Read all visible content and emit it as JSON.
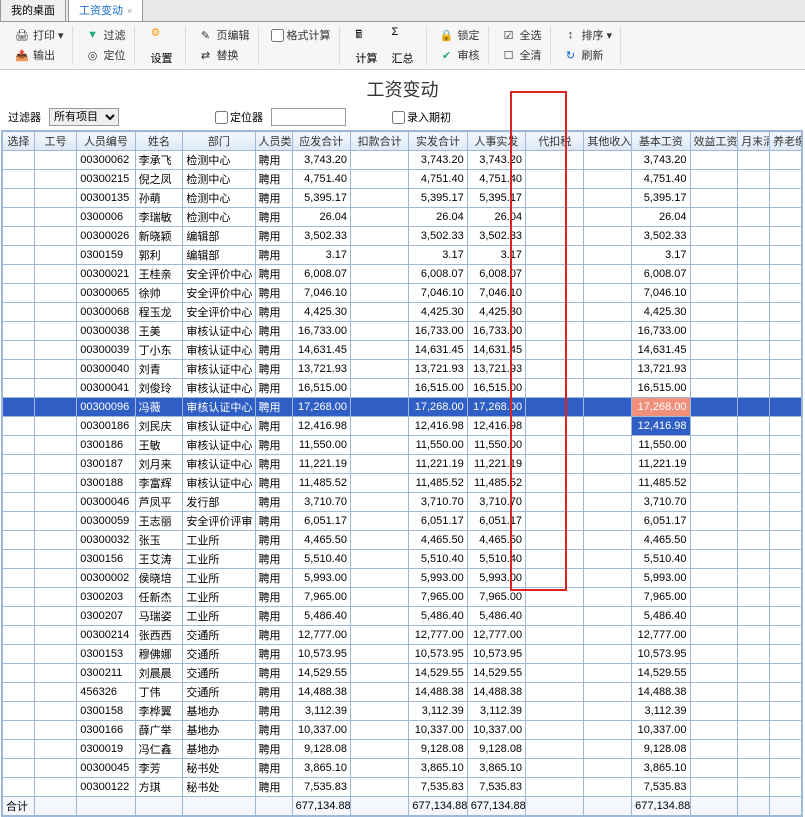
{
  "tabs": {
    "desktop": "我的桌面",
    "payroll": "工资变动"
  },
  "toolbar": {
    "print": "打印",
    "filter": "过滤",
    "output": "输出",
    "locate": "定位",
    "settings": "设置",
    "page_edit": "页编辑",
    "format_calc": "格式计算",
    "replace": "替换",
    "calc": "计算",
    "summary": "汇总",
    "lock": "锁定",
    "audit": "审核",
    "select_all": "全选",
    "clear_all": "全清",
    "sort": "排序",
    "refresh": "刷新"
  },
  "title": "工资变动",
  "filters": {
    "filter_label": "过滤器",
    "filter_value": "所有项目",
    "locator_label": "定位器",
    "import_period": "录入期初"
  },
  "columns": {
    "select": "选择",
    "work_no": "工号",
    "emp_no": "人员编号",
    "name": "姓名",
    "dept": "部门",
    "emp_type": "人员类别",
    "gross": "应发合计",
    "deduct": "扣款合计",
    "net": "实发合计",
    "hr_net": "人事实发",
    "tax": "代扣税",
    "other_income": "其他收入",
    "base": "基本工资",
    "benefit": "效益工资",
    "month_adj": "月末清欠",
    "pension": "养老缴"
  },
  "rows": [
    {
      "no": "00300062",
      "name": "李承飞",
      "dept": "检测中心",
      "type": "聘用",
      "gross": "3,743.20",
      "deduct": "",
      "net": "3,743.20",
      "hr": "3,743.20",
      "base": "3,743.20"
    },
    {
      "no": "00300215",
      "name": "倪之凤",
      "dept": "检测中心",
      "type": "聘用",
      "gross": "4,751.40",
      "deduct": "",
      "net": "4,751.40",
      "hr": "4,751.40",
      "base": "4,751.40"
    },
    {
      "no": "00300135",
      "name": "孙萌",
      "dept": "检测中心",
      "type": "聘用",
      "gross": "5,395.17",
      "deduct": "",
      "net": "5,395.17",
      "hr": "5,395.17",
      "base": "5,395.17"
    },
    {
      "no": "0300006",
      "name": "李瑞敏",
      "dept": "检测中心",
      "type": "聘用",
      "gross": "26.04",
      "deduct": "",
      "net": "26.04",
      "hr": "26.04",
      "base": "26.04"
    },
    {
      "no": "00300026",
      "name": "新晓颖",
      "dept": "编辑部",
      "type": "聘用",
      "gross": "3,502.33",
      "deduct": "",
      "net": "3,502.33",
      "hr": "3,502.33",
      "base": "3,502.33"
    },
    {
      "no": "0300159",
      "name": "郭利",
      "dept": "编辑部",
      "type": "聘用",
      "gross": "3.17",
      "deduct": "",
      "net": "3.17",
      "hr": "3.17",
      "base": "3.17"
    },
    {
      "no": "00300021",
      "name": "王桂亲",
      "dept": "安全评价中心",
      "type": "聘用",
      "gross": "6,008.07",
      "deduct": "",
      "net": "6,008.07",
      "hr": "6,008.07",
      "base": "6,008.07"
    },
    {
      "no": "00300065",
      "name": "徐帅",
      "dept": "安全评价中心",
      "type": "聘用",
      "gross": "7,046.10",
      "deduct": "",
      "net": "7,046.10",
      "hr": "7,046.10",
      "base": "7,046.10"
    },
    {
      "no": "00300068",
      "name": "程玉龙",
      "dept": "安全评价中心",
      "type": "聘用",
      "gross": "4,425.30",
      "deduct": "",
      "net": "4,425.30",
      "hr": "4,425.30",
      "base": "4,425.30"
    },
    {
      "no": "00300038",
      "name": "王美",
      "dept": "审核认证中心",
      "type": "聘用",
      "gross": "16,733.00",
      "deduct": "",
      "net": "16,733.00",
      "hr": "16,733.00",
      "base": "16,733.00"
    },
    {
      "no": "00300039",
      "name": "丁小东",
      "dept": "审核认证中心",
      "type": "聘用",
      "gross": "14,631.45",
      "deduct": "",
      "net": "14,631.45",
      "hr": "14,631.45",
      "base": "14,631.45"
    },
    {
      "no": "00300040",
      "name": "刘青",
      "dept": "审核认证中心",
      "type": "聘用",
      "gross": "13,721.93",
      "deduct": "",
      "net": "13,721.93",
      "hr": "13,721.93",
      "base": "13,721.93"
    },
    {
      "no": "00300041",
      "name": "刘俊玲",
      "dept": "审核认证中心",
      "type": "聘用",
      "gross": "16,515.00",
      "deduct": "",
      "net": "16,515.00",
      "hr": "16,515.00",
      "base": "16,515.00"
    },
    {
      "no": "00300096",
      "name": "冯薇",
      "dept": "审核认证中心",
      "type": "聘用",
      "gross": "17,268.00",
      "deduct": "",
      "net": "17,268.00",
      "hr": "17,268.00",
      "base": "17,268.00",
      "sel": true,
      "hl": true
    },
    {
      "no": "00300186",
      "name": "刘民庆",
      "dept": "审核认证中心",
      "type": "聘用",
      "gross": "12,416.98",
      "deduct": "",
      "net": "12,416.98",
      "hr": "12,416.98",
      "base": "12,416.98",
      "hl2": true
    },
    {
      "no": "0300186",
      "name": "王敏",
      "dept": "审核认证中心",
      "type": "聘用",
      "gross": "11,550.00",
      "deduct": "",
      "net": "11,550.00",
      "hr": "11,550.00",
      "base": "11,550.00"
    },
    {
      "no": "0300187",
      "name": "刘月来",
      "dept": "审核认证中心",
      "type": "聘用",
      "gross": "11,221.19",
      "deduct": "",
      "net": "11,221.19",
      "hr": "11,221.19",
      "base": "11,221.19"
    },
    {
      "no": "0300188",
      "name": "李富辉",
      "dept": "审核认证中心",
      "type": "聘用",
      "gross": "11,485.52",
      "deduct": "",
      "net": "11,485.52",
      "hr": "11,485.52",
      "base": "11,485.52"
    },
    {
      "no": "00300046",
      "name": "芦凤平",
      "dept": "发行部",
      "type": "聘用",
      "gross": "3,710.70",
      "deduct": "",
      "net": "3,710.70",
      "hr": "3,710.70",
      "base": "3,710.70"
    },
    {
      "no": "00300059",
      "name": "王志丽",
      "dept": "安全评价评审",
      "type": "聘用",
      "gross": "6,051.17",
      "deduct": "",
      "net": "6,051.17",
      "hr": "6,051.17",
      "base": "6,051.17"
    },
    {
      "no": "00300032",
      "name": "张玉",
      "dept": "工业所",
      "type": "聘用",
      "gross": "4,465.50",
      "deduct": "",
      "net": "4,465.50",
      "hr": "4,465.50",
      "base": "4,465.50"
    },
    {
      "no": "0300156",
      "name": "王艾涛",
      "dept": "工业所",
      "type": "聘用",
      "gross": "5,510.40",
      "deduct": "",
      "net": "5,510.40",
      "hr": "5,510.40",
      "base": "5,510.40"
    },
    {
      "no": "00300002",
      "name": "侯晓培",
      "dept": "工业所",
      "type": "聘用",
      "gross": "5,993.00",
      "deduct": "",
      "net": "5,993.00",
      "hr": "5,993.00",
      "base": "5,993.00"
    },
    {
      "no": "0300203",
      "name": "任新杰",
      "dept": "工业所",
      "type": "聘用",
      "gross": "7,965.00",
      "deduct": "",
      "net": "7,965.00",
      "hr": "7,965.00",
      "base": "7,965.00"
    },
    {
      "no": "0300207",
      "name": "马瑞姿",
      "dept": "工业所",
      "type": "聘用",
      "gross": "5,486.40",
      "deduct": "",
      "net": "5,486.40",
      "hr": "5,486.40",
      "base": "5,486.40"
    },
    {
      "no": "00300214",
      "name": "张西西",
      "dept": "交通所",
      "type": "聘用",
      "gross": "12,777.00",
      "deduct": "",
      "net": "12,777.00",
      "hr": "12,777.00",
      "base": "12,777.00"
    },
    {
      "no": "0300153",
      "name": "穆佛娜",
      "dept": "交通所",
      "type": "聘用",
      "gross": "10,573.95",
      "deduct": "",
      "net": "10,573.95",
      "hr": "10,573.95",
      "base": "10,573.95"
    },
    {
      "no": "0300211",
      "name": "刘晨晨",
      "dept": "交通所",
      "type": "聘用",
      "gross": "14,529.55",
      "deduct": "",
      "net": "14,529.55",
      "hr": "14,529.55",
      "base": "14,529.55"
    },
    {
      "no": "456326",
      "name": "丁伟",
      "dept": "交通所",
      "type": "聘用",
      "gross": "14,488.38",
      "deduct": "",
      "net": "14,488.38",
      "hr": "14,488.38",
      "base": "14,488.38"
    },
    {
      "no": "0300158",
      "name": "李桦翼",
      "dept": "基地办",
      "type": "聘用",
      "gross": "3,112.39",
      "deduct": "",
      "net": "3,112.39",
      "hr": "3,112.39",
      "base": "3,112.39"
    },
    {
      "no": "0300166",
      "name": "薛广举",
      "dept": "基地办",
      "type": "聘用",
      "gross": "10,337.00",
      "deduct": "",
      "net": "10,337.00",
      "hr": "10,337.00",
      "base": "10,337.00"
    },
    {
      "no": "0300019",
      "name": "冯仁鑫",
      "dept": "基地办",
      "type": "聘用",
      "gross": "9,128.08",
      "deduct": "",
      "net": "9,128.08",
      "hr": "9,128.08",
      "base": "9,128.08"
    },
    {
      "no": "00300045",
      "name": "李芳",
      "dept": "秘书处",
      "type": "聘用",
      "gross": "3,865.10",
      "deduct": "",
      "net": "3,865.10",
      "hr": "3,865.10",
      "base": "3,865.10"
    },
    {
      "no": "00300122",
      "name": "方琪",
      "dept": "秘书处",
      "type": "聘用",
      "gross": "7,535.83",
      "deduct": "",
      "net": "7,535.83",
      "hr": "7,535.83",
      "base": "7,535.83"
    }
  ],
  "total": {
    "label": "合计",
    "gross": "677,134.88",
    "net": "677,134.88",
    "hr": "677,134.88",
    "base": "677,134.88"
  }
}
